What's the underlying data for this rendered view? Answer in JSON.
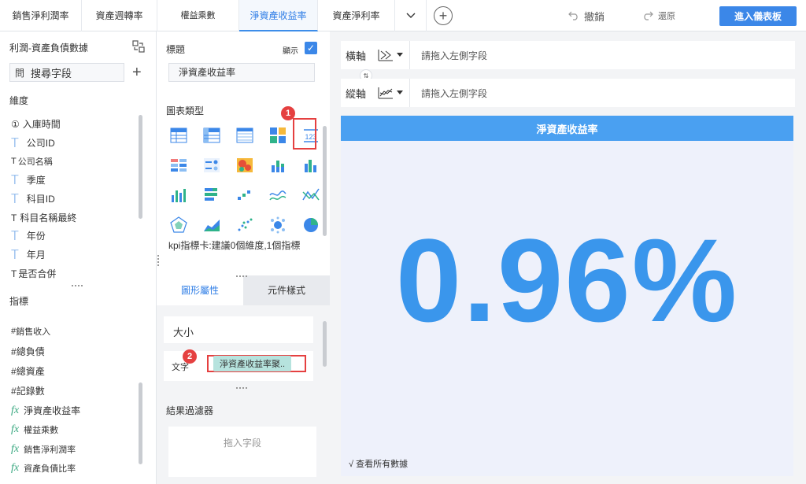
{
  "tabs": [
    "銷售淨利潤率",
    "資產週轉率",
    "權益乘數",
    "淨資產收益率",
    "資產淨利率"
  ],
  "active_tab": "淨資產收益率",
  "toolbar": {
    "undo": "撤銷",
    "redo": "還原",
    "enter_dashboard": "進入儀表板"
  },
  "left": {
    "dataset_title": "利潤-資產負債數據",
    "search_icon": "問",
    "search_placeholder": "搜尋字段",
    "dimension_label": "維度",
    "dimensions": [
      {
        "prefix": "①",
        "name": "入庫時間"
      },
      {
        "prefix": "T",
        "name": "公司ID"
      },
      {
        "prefix": "T",
        "name": "公司名稱"
      },
      {
        "prefix": "T",
        "name": "季度"
      },
      {
        "prefix": "T",
        "name": "科目ID"
      },
      {
        "prefix": "T",
        "name": "科目名稱最終"
      },
      {
        "prefix": "T",
        "name": "年份"
      },
      {
        "prefix": "T",
        "name": "年月"
      },
      {
        "prefix": "T",
        "name": "是否合併"
      }
    ],
    "metric_label": "指標",
    "metrics": [
      {
        "prefix": "#",
        "name": "銷售收入"
      },
      {
        "prefix": "#",
        "name": "總負債"
      },
      {
        "prefix": "#",
        "name": "總資產"
      },
      {
        "prefix": "#",
        "name": "記錄數"
      },
      {
        "prefix": "fx",
        "name": "淨資產收益率"
      },
      {
        "prefix": "fx",
        "name": "權益乘數"
      },
      {
        "prefix": "fx",
        "name": "銷售淨利潤率"
      },
      {
        "prefix": "fx",
        "name": "資產負債比率"
      }
    ]
  },
  "middle": {
    "title_label": "標題",
    "show_label": "顯示",
    "title_value": "淨資產收益率",
    "chart_type_label": "圖表類型",
    "chart_type_desc": "kpi指標卡:建議0個維度,1個指標",
    "kpi_icon_text": "123",
    "markers": [
      "1",
      "2"
    ],
    "attr_tabs": [
      "圖形屬性",
      "元件樣式"
    ],
    "size_label": "大小",
    "text_label": "文字",
    "text_field": "淨資產收益率聚..",
    "filter_label": "結果過濾器",
    "filter_drop": "拖入字段"
  },
  "right": {
    "x_label": "橫軸",
    "y_label": "縱軸",
    "x_hint": "請拖入左側字段",
    "y_hint": "請拖入左側字段",
    "chart_title": "淨資產收益率",
    "kpi_value": "0.96%",
    "view_all": "√ 查看所有數據"
  },
  "colors": {
    "accent": "#3b87e8",
    "kpi": "#3a96ec",
    "title_bar": "#4aa0f1",
    "marker": "#e54040"
  }
}
